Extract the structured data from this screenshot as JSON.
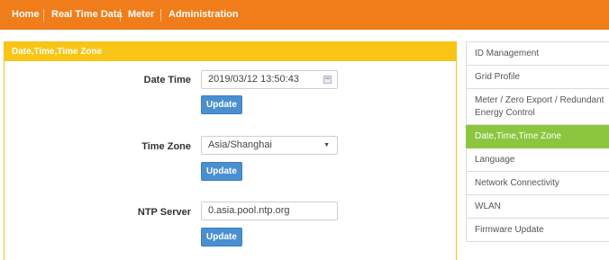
{
  "nav": {
    "home": "Home",
    "realtime": "Real Time Data",
    "meter": "Meter",
    "admin": "Administration"
  },
  "panel": {
    "title": "Date,Time,Time Zone",
    "datetime_label": "Date Time",
    "datetime_value": "2019/03/12 13:50:43",
    "timezone_label": "Time Zone",
    "timezone_value": "Asia/Shanghai",
    "ntp_label": "NTP Server",
    "ntp_value": "0.asia.pool.ntp.org",
    "update_label": "Update"
  },
  "menu": [
    {
      "label": "ID Management"
    },
    {
      "label": "Grid Profile"
    },
    {
      "label": "Meter / Zero Export / Redundant Energy Control"
    },
    {
      "label": "Date,Time,Time Zone",
      "active": true
    },
    {
      "label": "Language"
    },
    {
      "label": "Network Connectivity"
    },
    {
      "label": "WLAN"
    },
    {
      "label": "Firmware Update"
    }
  ],
  "colors": {
    "nav_bg": "#f07d1a",
    "panel_header": "#f8c516",
    "button": "#4a8fd0",
    "menu_active": "#8cc63f"
  }
}
